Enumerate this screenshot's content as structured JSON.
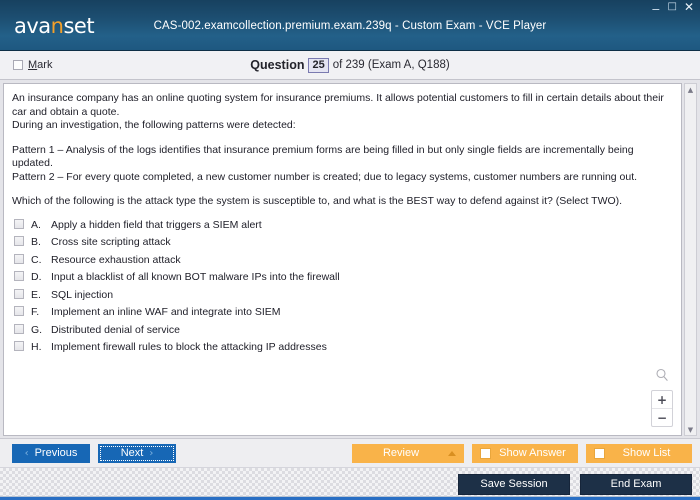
{
  "window": {
    "logo_main_1": "ava",
    "logo_accent": "n",
    "logo_main_2": "set",
    "title": "CAS-002.examcollection.premium.exam.239q - Custom Exam - VCE Player",
    "minimize_icon": "minimize-icon",
    "maximize_icon": "maximize-icon",
    "close_icon": "close-icon",
    "minimize_glyph": "−",
    "maximize_glyph": "□",
    "close_glyph": "✕",
    "titlebar_color": "#1d4f72",
    "accent_color": "#f3a02a"
  },
  "question_header": {
    "mark_label_prefix": "M",
    "mark_label_rest": "ark",
    "question_word": "Question",
    "question_number": "25",
    "question_rest": "of 239 (Exam A, Q188)"
  },
  "question": {
    "paragraph_1": "An insurance company has an online quoting system for insurance premiums. It allows potential customers to fill in certain details about their car and obtain a quote.",
    "paragraph_2": "During an investigation, the following patterns were detected:",
    "pattern_1": "Pattern 1 – Analysis of the logs identifies that insurance premium forms are being filled in but only single fields are incrementally being updated.",
    "pattern_2": "Pattern 2 – For every quote completed, a new customer number is created; due to legacy systems, customer numbers are running out.",
    "prompt": "Which of the following is the attack type the system is susceptible to, and what is the BEST way to defend against it? (Select TWO)."
  },
  "options": [
    {
      "letter": "A.",
      "text": "Apply a hidden field that triggers a SIEM alert",
      "checked": false
    },
    {
      "letter": "B.",
      "text": "Cross site scripting attack",
      "checked": false
    },
    {
      "letter": "C.",
      "text": "Resource exhaustion attack",
      "checked": false
    },
    {
      "letter": "D.",
      "text": "Input a blacklist of all known BOT malware IPs into the firewall",
      "checked": false
    },
    {
      "letter": "E.",
      "text": "SQL injection",
      "checked": false
    },
    {
      "letter": "F.",
      "text": "Implement an inline WAF and integrate into SIEM",
      "checked": false
    },
    {
      "letter": "G.",
      "text": "Distributed denial of service",
      "checked": false
    },
    {
      "letter": "H.",
      "text": "Implement firewall rules to block the attacking IP addresses",
      "checked": false
    }
  ],
  "zoom_controls": {
    "magnifier_icon": "magnifier-icon",
    "zoom_in_label": "+",
    "zoom_out_label": "−"
  },
  "scrollbar": {
    "up_glyph": "▲",
    "down_glyph": "▼"
  },
  "navbar": {
    "previous_label": "Previous",
    "previous_chevron": "‹",
    "next_label": "Next",
    "next_chevron": "›",
    "review_label": "Review",
    "show_answer_label": "Show Answer",
    "show_list_label": "Show List",
    "orange_color": "#f9b349",
    "blue_color": "#1767b5"
  },
  "statusbar": {
    "save_session_label": "Save Session",
    "end_exam_label": "End Exam",
    "dark_color": "#1d3047",
    "accent_line_color": "#2a6fc4"
  }
}
